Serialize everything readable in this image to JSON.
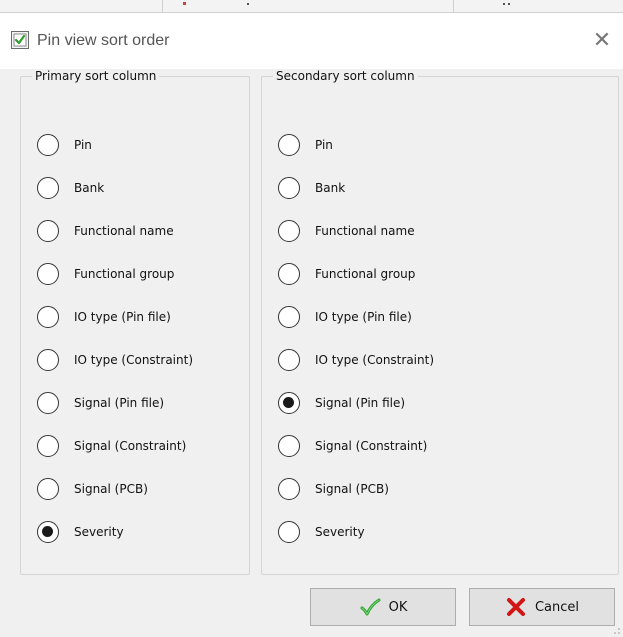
{
  "dialog": {
    "title": "Pin view sort order",
    "close_glyph": "✕"
  },
  "primary": {
    "legend": "Primary sort column",
    "selected": "Severity",
    "options": [
      {
        "label": "Pin",
        "checked": false
      },
      {
        "label": "Bank",
        "checked": false
      },
      {
        "label": "Functional name",
        "checked": false
      },
      {
        "label": "Functional group",
        "checked": false
      },
      {
        "label": "IO type (Pin file)",
        "checked": false
      },
      {
        "label": "IO type (Constraint)",
        "checked": false
      },
      {
        "label": "Signal (Pin file)",
        "checked": false
      },
      {
        "label": "Signal (Constraint)",
        "checked": false
      },
      {
        "label": "Signal (PCB)",
        "checked": false
      },
      {
        "label": "Severity",
        "checked": true
      }
    ]
  },
  "secondary": {
    "legend": "Secondary sort column",
    "selected": "Signal (Pin file)",
    "options": [
      {
        "label": "Pin",
        "checked": false
      },
      {
        "label": "Bank",
        "checked": false
      },
      {
        "label": "Functional name",
        "checked": false
      },
      {
        "label": "Functional group",
        "checked": false
      },
      {
        "label": "IO type (Pin file)",
        "checked": false
      },
      {
        "label": "IO type (Constraint)",
        "checked": false
      },
      {
        "label": "Signal (Pin file)",
        "checked": true
      },
      {
        "label": "Signal (Constraint)",
        "checked": false
      },
      {
        "label": "Signal (PCB)",
        "checked": false
      },
      {
        "label": "Severity",
        "checked": false
      }
    ]
  },
  "buttons": {
    "ok": {
      "label": "OK",
      "icon": "green-checkmark-icon"
    },
    "cancel": {
      "label": "Cancel",
      "icon": "red-x-icon"
    }
  },
  "colors": {
    "ok_icon": "#2fa52f",
    "cancel_icon": "#d21414",
    "client_bg": "#f0f0f0",
    "button_bg": "#e1e1e1"
  }
}
